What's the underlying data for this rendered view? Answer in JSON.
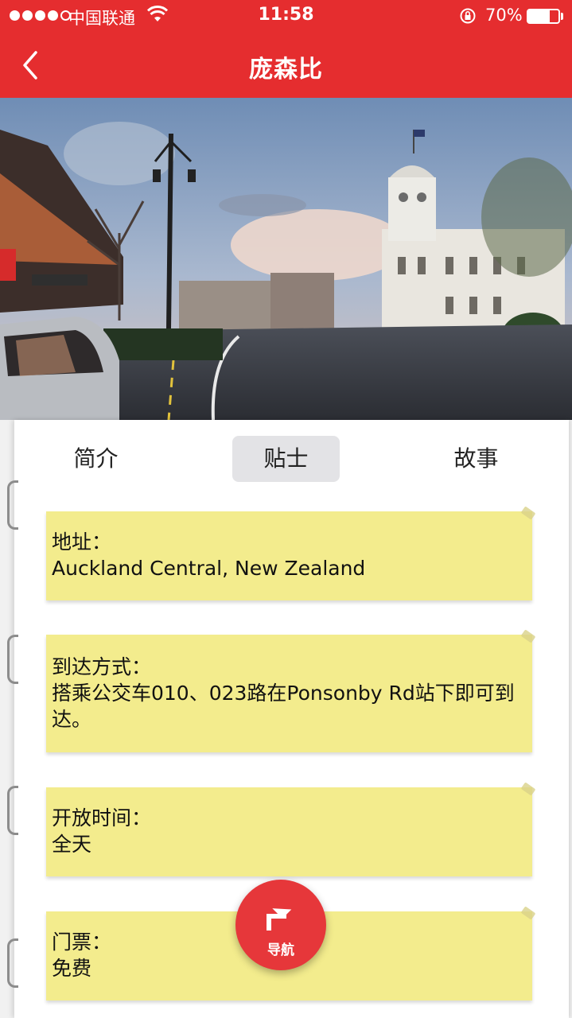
{
  "status_bar": {
    "carrier": "中国联通",
    "time": "11:58",
    "battery_text": "70%",
    "battery_level": 0.7
  },
  "nav": {
    "title": "庞森比",
    "back_icon": "chevron-left-icon"
  },
  "colors": {
    "brand": "#e52d2f",
    "note": "#f3ec8d",
    "tab_active": "#e3e3e6"
  },
  "tabs": [
    {
      "label": "简介",
      "active": false
    },
    {
      "label": "贴士",
      "active": true
    },
    {
      "label": "故事",
      "active": false
    }
  ],
  "notes": [
    {
      "label": "地址：",
      "value": "Auckland Central, New Zealand"
    },
    {
      "label": "到达方式：",
      "value": "搭乘公交车010、023路在Ponsonby Rd站下即可到达。"
    },
    {
      "label": "开放时间：",
      "value": "全天"
    },
    {
      "label": "门票：",
      "value": "免费"
    }
  ],
  "fab": {
    "label": "导航",
    "icon": "turn-right-arrow-icon"
  }
}
